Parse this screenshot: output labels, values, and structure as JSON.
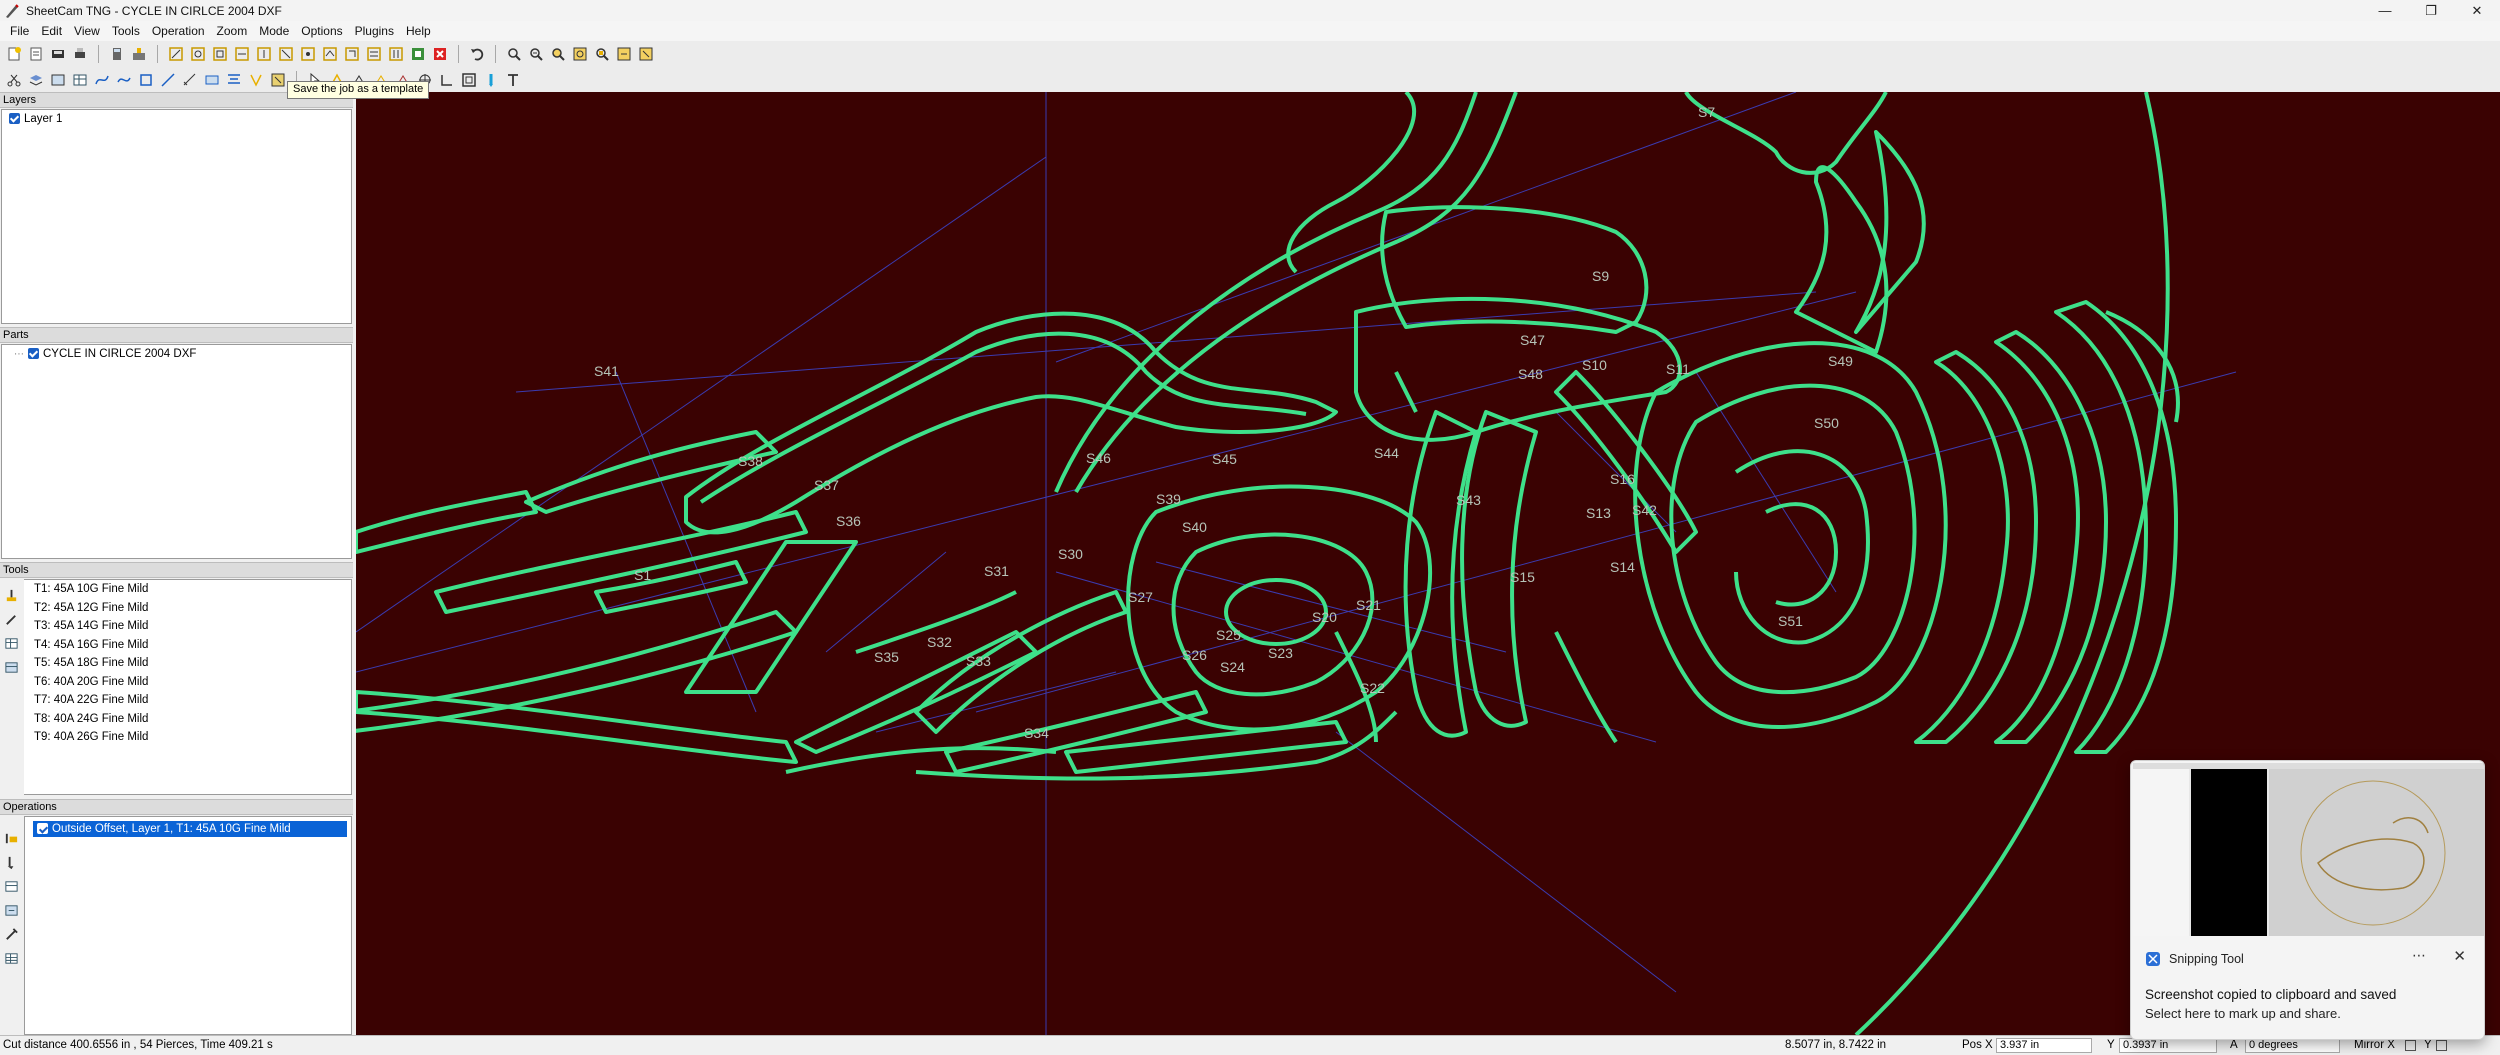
{
  "window": {
    "title": "SheetCam TNG - CYCLE IN CIRLCE 2004 DXF"
  },
  "menu": [
    "File",
    "Edit",
    "View",
    "Tools",
    "Operation",
    "Zoom",
    "Mode",
    "Options",
    "Plugins",
    "Help"
  ],
  "tooltip": "Save the job as a template",
  "layers": {
    "header": "Layers",
    "items": [
      "Layer 1"
    ]
  },
  "parts": {
    "header": "Parts",
    "items": [
      "CYCLE IN CIRLCE 2004 DXF"
    ]
  },
  "tools": {
    "header": "Tools",
    "items": [
      "T1: 45A 10G Fine Mild",
      "T2: 45A 12G Fine Mild",
      "T3: 45A 14G Fine Mild",
      "T4: 45A 16G Fine Mild",
      "T5: 45A 18G Fine Mild",
      "T6: 40A 20G Fine Mild",
      "T7: 40A 22G Fine Mild",
      "T8: 40A 24G Fine Mild",
      "T9: 40A 26G Fine Mild"
    ]
  },
  "operations": {
    "header": "Operations",
    "items": [
      "Outside Offset, Layer 1, T1: 45A 10G Fine Mild"
    ]
  },
  "canvas": {
    "labels": [
      "S7",
      "S9",
      "S47",
      "S48",
      "S10",
      "S11",
      "S49",
      "S50",
      "S41",
      "S38",
      "S37",
      "S36",
      "S1",
      "S46",
      "S45",
      "S44",
      "S43",
      "S42",
      "S39",
      "S40",
      "S30",
      "S31",
      "S32",
      "S33",
      "S34",
      "S35",
      "S27",
      "S26",
      "S25",
      "S24",
      "S23",
      "S22",
      "S21",
      "S20",
      "S13",
      "S14",
      "S15",
      "S16",
      "S51"
    ]
  },
  "notification": {
    "app": "Snipping Tool",
    "message": "Screenshot copied to clipboard and saved",
    "sub": "Select here to mark up and share."
  },
  "status": {
    "cut_info": "Cut distance 400.6556 in , 54 Pierces, Time 409.21 s",
    "coords": "8.5077 in, 8.7422 in",
    "pos_x_label": "Pos X",
    "pos_x": "3.937 in",
    "y_label": "Y",
    "y": "0.3937 in",
    "a_label": "A",
    "a": "0 degrees",
    "mirror_x": "Mirror X",
    "mirror_y": "Y"
  },
  "colors": {
    "canvas_bg": "#3a0202",
    "path": "#3ee08a",
    "rapid": "#3a3aa8",
    "selection": "#0a63d6"
  }
}
